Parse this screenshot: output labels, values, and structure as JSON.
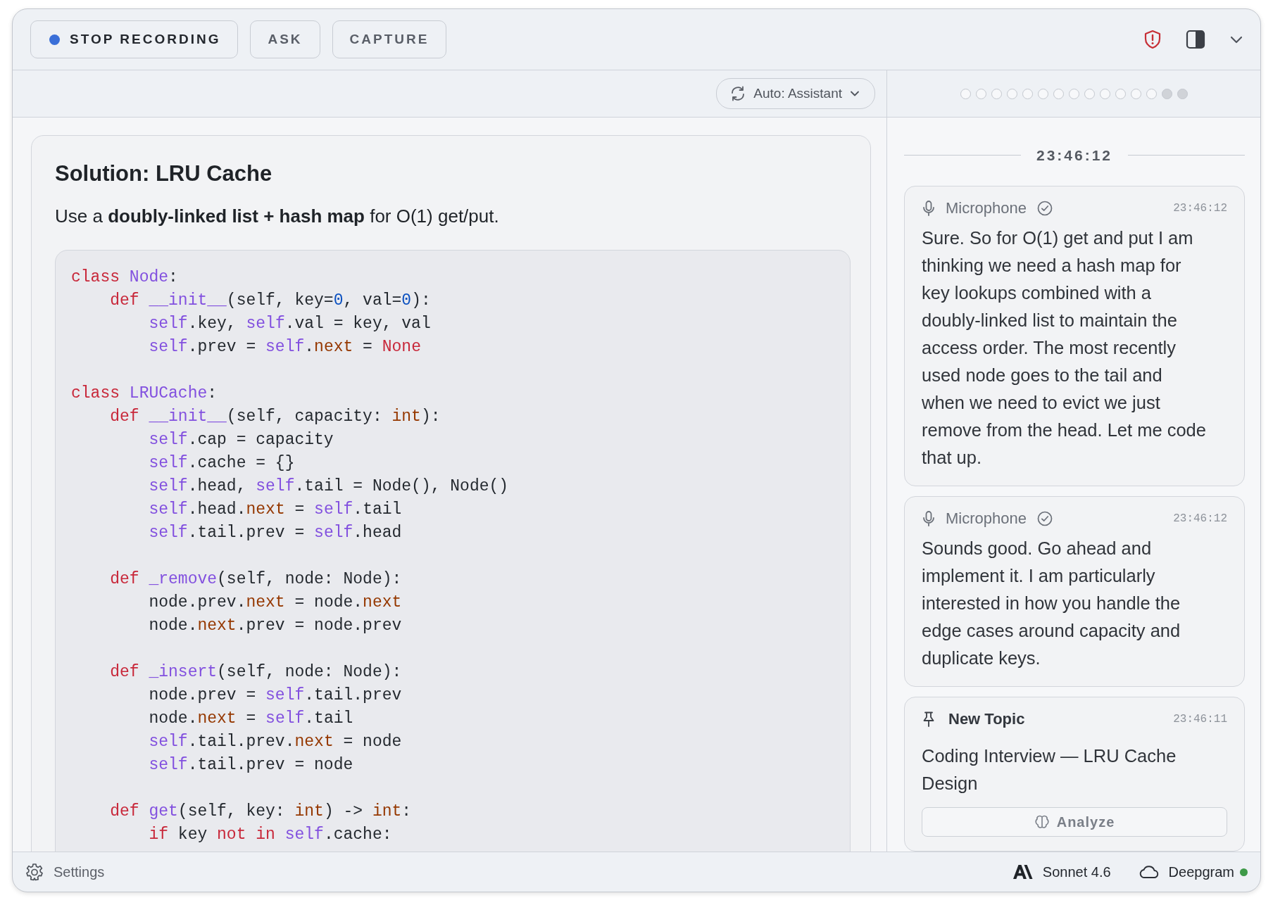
{
  "toolbar": {
    "buttons": [
      {
        "kind": "record",
        "label": "STOP RECORDING",
        "recording": true
      },
      {
        "kind": "plain",
        "label": "ASK"
      },
      {
        "kind": "plain",
        "label": "CAPTURE"
      }
    ]
  },
  "mode_dropdown": {
    "label": "Auto: Assistant"
  },
  "progress_dots": [
    {
      "filled": false
    },
    {
      "filled": false
    },
    {
      "filled": false
    },
    {
      "filled": false
    },
    {
      "filled": false
    },
    {
      "filled": false
    },
    {
      "filled": false
    },
    {
      "filled": false
    },
    {
      "filled": false
    },
    {
      "filled": false
    },
    {
      "filled": false
    },
    {
      "filled": false
    },
    {
      "filled": false
    },
    {
      "filled": true
    },
    {
      "filled": true
    }
  ],
  "answer": {
    "title": "Solution: LRU Cache",
    "summary": "Use a **doubly-linked list + hash map** for O(1) get/put.",
    "code_lines": [
      {
        "kind": "code",
        "tokens": [
          {
            "kind": "kw",
            "text": "class "
          },
          {
            "kind": "name",
            "text": "Node"
          },
          {
            "kind": "plain",
            "text": ":"
          }
        ]
      },
      {
        "kind": "code",
        "tokens": [
          {
            "kind": "kw",
            "text": "    def "
          },
          {
            "kind": "name",
            "text": "__init__"
          },
          {
            "kind": "plain",
            "text": "(self, key="
          },
          {
            "kind": "num",
            "text": "0"
          },
          {
            "kind": "plain",
            "text": ", val="
          },
          {
            "kind": "num",
            "text": "0"
          },
          {
            "kind": "plain",
            "text": "):"
          }
        ]
      },
      {
        "kind": "code",
        "tokens": [
          {
            "kind": "name",
            "text": "        self"
          },
          {
            "kind": "plain",
            "text": ".key, "
          },
          {
            "kind": "name",
            "text": "self"
          },
          {
            "kind": "plain",
            "text": ".val = key, val"
          }
        ]
      },
      {
        "kind": "code",
        "tokens": [
          {
            "kind": "name",
            "text": "        self"
          },
          {
            "kind": "plain",
            "text": ".prev = "
          },
          {
            "kind": "name",
            "text": "self"
          },
          {
            "kind": "plain",
            "text": "."
          },
          {
            "kind": "attr",
            "text": "next"
          },
          {
            "kind": "plain",
            "text": " = "
          },
          {
            "kind": "kw",
            "text": "None"
          }
        ]
      },
      {
        "kind": "blank"
      },
      {
        "kind": "code",
        "tokens": [
          {
            "kind": "kw",
            "text": "class "
          },
          {
            "kind": "name",
            "text": "LRUCache"
          },
          {
            "kind": "plain",
            "text": ":"
          }
        ]
      },
      {
        "kind": "code",
        "tokens": [
          {
            "kind": "kw",
            "text": "    def "
          },
          {
            "kind": "name",
            "text": "__init__"
          },
          {
            "kind": "plain",
            "text": "(self, capacity: "
          },
          {
            "kind": "attr",
            "text": "int"
          },
          {
            "kind": "plain",
            "text": "):"
          }
        ]
      },
      {
        "kind": "code",
        "tokens": [
          {
            "kind": "name",
            "text": "        self"
          },
          {
            "kind": "plain",
            "text": ".cap = capacity"
          }
        ]
      },
      {
        "kind": "code",
        "tokens": [
          {
            "kind": "name",
            "text": "        self"
          },
          {
            "kind": "plain",
            "text": ".cache = {}"
          }
        ]
      },
      {
        "kind": "code",
        "tokens": [
          {
            "kind": "name",
            "text": "        self"
          },
          {
            "kind": "plain",
            "text": ".head, "
          },
          {
            "kind": "name",
            "text": "self"
          },
          {
            "kind": "plain",
            "text": ".tail = Node(), Node()"
          }
        ]
      },
      {
        "kind": "code",
        "tokens": [
          {
            "kind": "name",
            "text": "        self"
          },
          {
            "kind": "plain",
            "text": ".head."
          },
          {
            "kind": "attr",
            "text": "next"
          },
          {
            "kind": "plain",
            "text": " = "
          },
          {
            "kind": "name",
            "text": "self"
          },
          {
            "kind": "plain",
            "text": ".tail"
          }
        ]
      },
      {
        "kind": "code",
        "tokens": [
          {
            "kind": "name",
            "text": "        self"
          },
          {
            "kind": "plain",
            "text": ".tail.prev = "
          },
          {
            "kind": "name",
            "text": "self"
          },
          {
            "kind": "plain",
            "text": ".head"
          }
        ]
      },
      {
        "kind": "blank"
      },
      {
        "kind": "code",
        "tokens": [
          {
            "kind": "kw",
            "text": "    def "
          },
          {
            "kind": "name",
            "text": "_remove"
          },
          {
            "kind": "plain",
            "text": "(self, node: Node):"
          }
        ]
      },
      {
        "kind": "code",
        "tokens": [
          {
            "kind": "plain",
            "text": "        node.prev."
          },
          {
            "kind": "attr",
            "text": "next"
          },
          {
            "kind": "plain",
            "text": " = node."
          },
          {
            "kind": "attr",
            "text": "next"
          }
        ]
      },
      {
        "kind": "code",
        "tokens": [
          {
            "kind": "plain",
            "text": "        node."
          },
          {
            "kind": "attr",
            "text": "next"
          },
          {
            "kind": "plain",
            "text": ".prev = node.prev"
          }
        ]
      },
      {
        "kind": "blank"
      },
      {
        "kind": "code",
        "tokens": [
          {
            "kind": "kw",
            "text": "    def "
          },
          {
            "kind": "name",
            "text": "_insert"
          },
          {
            "kind": "plain",
            "text": "(self, node: Node):"
          }
        ]
      },
      {
        "kind": "code",
        "tokens": [
          {
            "kind": "plain",
            "text": "        node.prev = "
          },
          {
            "kind": "name",
            "text": "self"
          },
          {
            "kind": "plain",
            "text": ".tail.prev"
          }
        ]
      },
      {
        "kind": "code",
        "tokens": [
          {
            "kind": "plain",
            "text": "        node."
          },
          {
            "kind": "attr",
            "text": "next"
          },
          {
            "kind": "plain",
            "text": " = "
          },
          {
            "kind": "name",
            "text": "self"
          },
          {
            "kind": "plain",
            "text": ".tail"
          }
        ]
      },
      {
        "kind": "code",
        "tokens": [
          {
            "kind": "name",
            "text": "        self"
          },
          {
            "kind": "plain",
            "text": ".tail.prev."
          },
          {
            "kind": "attr",
            "text": "next"
          },
          {
            "kind": "plain",
            "text": " = node"
          }
        ]
      },
      {
        "kind": "code",
        "tokens": [
          {
            "kind": "name",
            "text": "        self"
          },
          {
            "kind": "plain",
            "text": ".tail.prev = node"
          }
        ]
      },
      {
        "kind": "blank"
      },
      {
        "kind": "code",
        "tokens": [
          {
            "kind": "kw",
            "text": "    def "
          },
          {
            "kind": "name",
            "text": "get"
          },
          {
            "kind": "plain",
            "text": "(self, key: "
          },
          {
            "kind": "attr",
            "text": "int"
          },
          {
            "kind": "plain",
            "text": ") -> "
          },
          {
            "kind": "attr",
            "text": "int"
          },
          {
            "kind": "plain",
            "text": ":"
          }
        ]
      },
      {
        "kind": "code",
        "tokens": [
          {
            "kind": "kw",
            "text": "        if"
          },
          {
            "kind": "plain",
            "text": " key "
          },
          {
            "kind": "kw",
            "text": "not in "
          },
          {
            "kind": "name",
            "text": "self"
          },
          {
            "kind": "plain",
            "text": ".cache:"
          }
        ]
      }
    ]
  },
  "transcript": {
    "time_divider": "23:46:12",
    "entries": [
      {
        "kind": "speech",
        "source": "Microphone",
        "verified": true,
        "time": "23:46:12",
        "text": "Sure. So for O(1) get and put I am thinking we need a hash map for key lookups combined with a doubly-linked list to maintain the access order. The most recently used node goes to the tail and when we need to evict we just remove from the head. Let me code that up."
      },
      {
        "kind": "speech",
        "source": "Microphone",
        "verified": true,
        "time": "23:46:12",
        "text": "Sounds good. Go ahead and implement it. I am particularly interested in how you handle the edge cases around capacity and duplicate keys."
      },
      {
        "kind": "topic",
        "title": "New Topic",
        "time": "23:46:11",
        "text": "Coding Interview — LRU Cache Design",
        "action": "Analyze"
      }
    ]
  },
  "status_bar": {
    "settings": "Settings",
    "model": "Sonnet 4.6",
    "transcriber": "Deepgram",
    "connected": true
  }
}
